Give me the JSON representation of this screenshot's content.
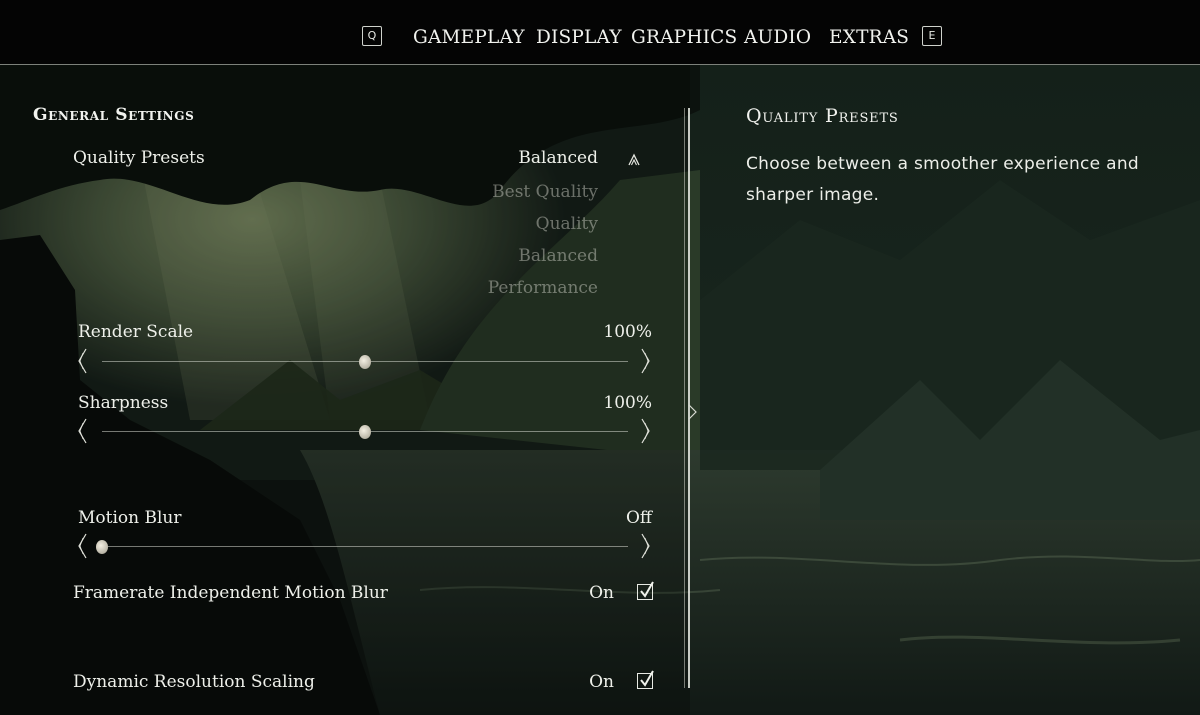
{
  "nav": {
    "prev_key": "Q",
    "next_key": "E",
    "tabs": [
      {
        "label": "GAMEPLAY"
      },
      {
        "label": "DISPLAY"
      },
      {
        "label": "GRAPHICS"
      },
      {
        "label": "AUDIO"
      },
      {
        "label": "EXTRAS"
      }
    ]
  },
  "settings": {
    "section_title": "General Settings",
    "quality_presets": {
      "label": "Quality Presets",
      "value": "Balanced",
      "options": [
        "Best Quality",
        "Quality",
        "Balanced",
        "Performance"
      ]
    },
    "render_scale": {
      "label": "Render Scale",
      "value": "100%",
      "level": 0.5
    },
    "sharpness": {
      "label": "Sharpness",
      "value": "100%",
      "level": 0.5
    },
    "motion_blur": {
      "label": "Motion Blur",
      "value": "Off",
      "level": 0.0
    },
    "framerate_motion_blur": {
      "label": "Framerate Independent Motion Blur",
      "value": "On",
      "checked": true
    },
    "dynamic_resolution": {
      "label": "Dynamic Resolution Scaling",
      "value": "On",
      "checked": true
    }
  },
  "description": {
    "title": "Quality Presets",
    "text": "Choose between a smoother experience and sharper image."
  },
  "colors": {
    "background": "#0b0f0d",
    "text": "#eef0ea",
    "muted_option": "#e6e8de",
    "scene_green": "#3a4a36"
  }
}
